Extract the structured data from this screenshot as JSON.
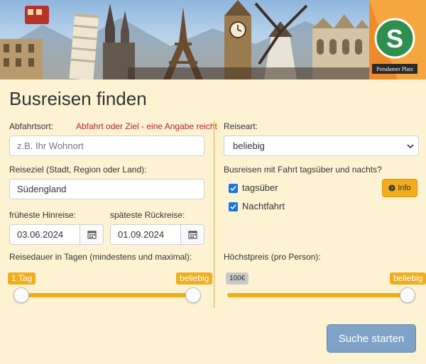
{
  "form": {
    "title": "Busreisen finden",
    "departure": {
      "label": "Abfahrtsort:",
      "hint": "Abfahrt oder Ziel - eine Angabe reicht",
      "placeholder": "z.B. Ihr Wohnort",
      "value": ""
    },
    "destination": {
      "label": "Reiseziel (Stadt, Region oder Land):",
      "value": "Südengland"
    },
    "earliest": {
      "label": "früheste Hinreise:",
      "value": "03.06.2024"
    },
    "latest": {
      "label": "späteste Rückreise:",
      "value": "01.09.2024"
    },
    "duration": {
      "label": "Reisedauer in Tagen (mindestens und maximal):",
      "min_tag": "1 Tag",
      "max_tag": "beliebig",
      "min_fraction": 0.0,
      "max_fraction": 1.0
    },
    "travel_type": {
      "label": "Reiseart:",
      "selected": "beliebig"
    },
    "day_night": {
      "label": "Busreisen mit Fahrt tagsüber und nachts?",
      "options": [
        {
          "label": "tagsüber",
          "checked": true
        },
        {
          "label": "Nachtfahrt",
          "checked": true
        }
      ]
    },
    "info_button": "Info",
    "max_price": {
      "label": "Höchstpreis (pro Person):",
      "min_tag": "100€",
      "max_tag": "beliebig",
      "fraction": 1.0
    },
    "submit": "Suche starten"
  },
  "banner": {
    "sign_letter": "S",
    "sign_text": "Potsdamer Platz"
  },
  "colors": {
    "accent": "#f0ad1c",
    "background": "#fdf3d2",
    "submit": "#7fa3c7",
    "hint_red": "#b0282c",
    "checkbox": "#1a73e8"
  }
}
